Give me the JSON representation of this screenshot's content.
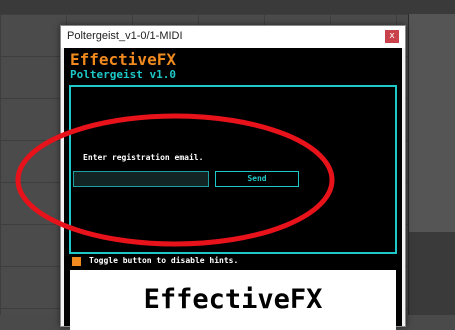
{
  "window": {
    "title": "Poltergeist_v1-0/1-MIDI",
    "close_glyph": "x"
  },
  "plugin": {
    "brand": "EffectiveFX",
    "product": "Poltergeist v1.0",
    "registration": {
      "prompt": "Enter registration email.",
      "email_value": "",
      "send_label": "Send"
    },
    "hint_text": "Toggle button to disable hints.",
    "logo_text": "EffectiveFX"
  },
  "colors": {
    "brand_orange": "#f08a1e",
    "accent_cyan": "#1ec8c8",
    "annotation_red": "#e8121b"
  },
  "icons": {
    "close": "close-icon",
    "hint_toggle": "hint-toggle-square"
  }
}
